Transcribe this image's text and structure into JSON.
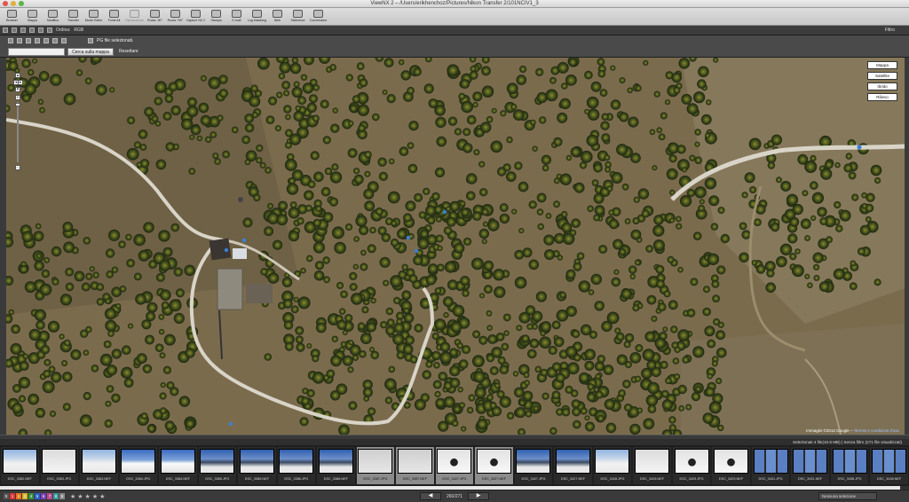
{
  "window": {
    "title": "ViewNX 2 – /Users/erikhenchoz/Pictures/Nikon Transfer 2/101NCIV1_3"
  },
  "toolbar": [
    {
      "label": "Browser",
      "icon": "browser-icon"
    },
    {
      "label": "Mappa",
      "icon": "map-icon"
    },
    {
      "label": "Modifica",
      "icon": "edit-icon"
    },
    {
      "label": "Transfer",
      "icon": "transfer-icon"
    },
    {
      "label": "Movie Editor",
      "icon": "movie-editor-icon"
    },
    {
      "label": "Fonte All",
      "icon": "source-icon"
    },
    {
      "label": "Riproduzione",
      "icon": "play-icon",
      "disabled": true
    },
    {
      "label": "Ruota -90°",
      "icon": "rotate-left-icon"
    },
    {
      "label": "Ruota +90°",
      "icon": "rotate-right-icon"
    },
    {
      "label": "Capture NX 2",
      "icon": "capture-nx-icon"
    },
    {
      "label": "Stampa",
      "icon": "print-icon"
    },
    {
      "label": "E-mail",
      "icon": "mail-icon"
    },
    {
      "label": "Log Matching",
      "icon": "log-matching-icon"
    },
    {
      "label": "Web",
      "icon": "web-icon"
    },
    {
      "label": "Slideshow",
      "icon": "slideshow-icon"
    },
    {
      "label": "Conversione",
      "icon": "convert-icon"
    }
  ],
  "bar2": {
    "order_label": "Ordina:",
    "order_value": "RGB",
    "right_label": "Filtro"
  },
  "bar3": {
    "selection_text": "PG file selezionati."
  },
  "searchbar": {
    "placeholder": "",
    "search_button": "Cerca sulla mappa",
    "reset_link": "Resettare"
  },
  "map": {
    "map_types": [
      "Mappa",
      "Satellite",
      "Ibrido",
      "Rilievo"
    ],
    "selected_map_type": "Satellite",
    "zoom_in": "+",
    "zoom_out": "−",
    "attribution": "Immagini ©2012 Google – ",
    "attribution_link": "Termini e condizioni d'uso"
  },
  "status_line": "Selezionati 4 file(10.8 MB) | Senza filtro (271 file visualizzati)",
  "thumbnails": [
    {
      "name": "DSC_3382.NEF",
      "sel": false,
      "kind": "snow"
    },
    {
      "name": "DSC_3383.JPG",
      "sel": false,
      "kind": "skier"
    },
    {
      "name": "DSC_3383.NEF",
      "sel": false,
      "kind": "snow"
    },
    {
      "name": "DSC_3384.JPG",
      "sel": false,
      "kind": "snow2"
    },
    {
      "name": "DSC_3384.NEF",
      "sel": false,
      "kind": "snow2"
    },
    {
      "name": "DSC_3385.JPG",
      "sel": false,
      "kind": "mtn"
    },
    {
      "name": "DSC_3385.NEF",
      "sel": false,
      "kind": "mtn"
    },
    {
      "name": "DSC_3386.JPG",
      "sel": false,
      "kind": "mtn"
    },
    {
      "name": "DSC_3386.NEF",
      "sel": false,
      "kind": "mtn"
    },
    {
      "name": "DSC_3387.JPG",
      "sel": true,
      "kind": "grey"
    },
    {
      "name": "DSC_3387.NEF",
      "sel": true,
      "kind": "grey"
    },
    {
      "name": "DSC_3427.JPG",
      "sel": true,
      "kind": "skier2"
    },
    {
      "name": "DSC_3427.NEF",
      "sel": true,
      "kind": "skier2"
    },
    {
      "name": "DSC_3427.JPG",
      "sel": false,
      "kind": "mtn"
    },
    {
      "name": "DSC_3427.NEF",
      "sel": false,
      "kind": "mtn"
    },
    {
      "name": "DSC_3428.JPG",
      "sel": false,
      "kind": "snow"
    },
    {
      "name": "DSC_3428.NEF",
      "sel": false,
      "kind": "skier"
    },
    {
      "name": "DSC_3429.JPG",
      "sel": false,
      "kind": "skier2"
    },
    {
      "name": "DSC_3429.NEF",
      "sel": false,
      "kind": "skier2"
    },
    {
      "name": "DSC_3431.JPG",
      "sel": false,
      "kind": "trees"
    },
    {
      "name": "DSC_3431.NEF",
      "sel": false,
      "kind": "trees"
    },
    {
      "name": "DSC_3438.JPG",
      "sel": false,
      "kind": "trees"
    },
    {
      "name": "DSC_3438.NEF",
      "sel": false,
      "kind": "trees"
    }
  ],
  "progress": 0.99,
  "bottom": {
    "color_labels": [
      "0",
      "1",
      "2",
      "3",
      "4",
      "5",
      "6",
      "7",
      "8",
      "9"
    ],
    "stars": "★★★★★",
    "pager_prev": "◀",
    "pager_text": "260/271",
    "pager_next": "▶",
    "sort_select": "Nessuna selezione"
  },
  "colors": {
    "accent": "#3b7fd6",
    "road": "#d9d4c8"
  }
}
